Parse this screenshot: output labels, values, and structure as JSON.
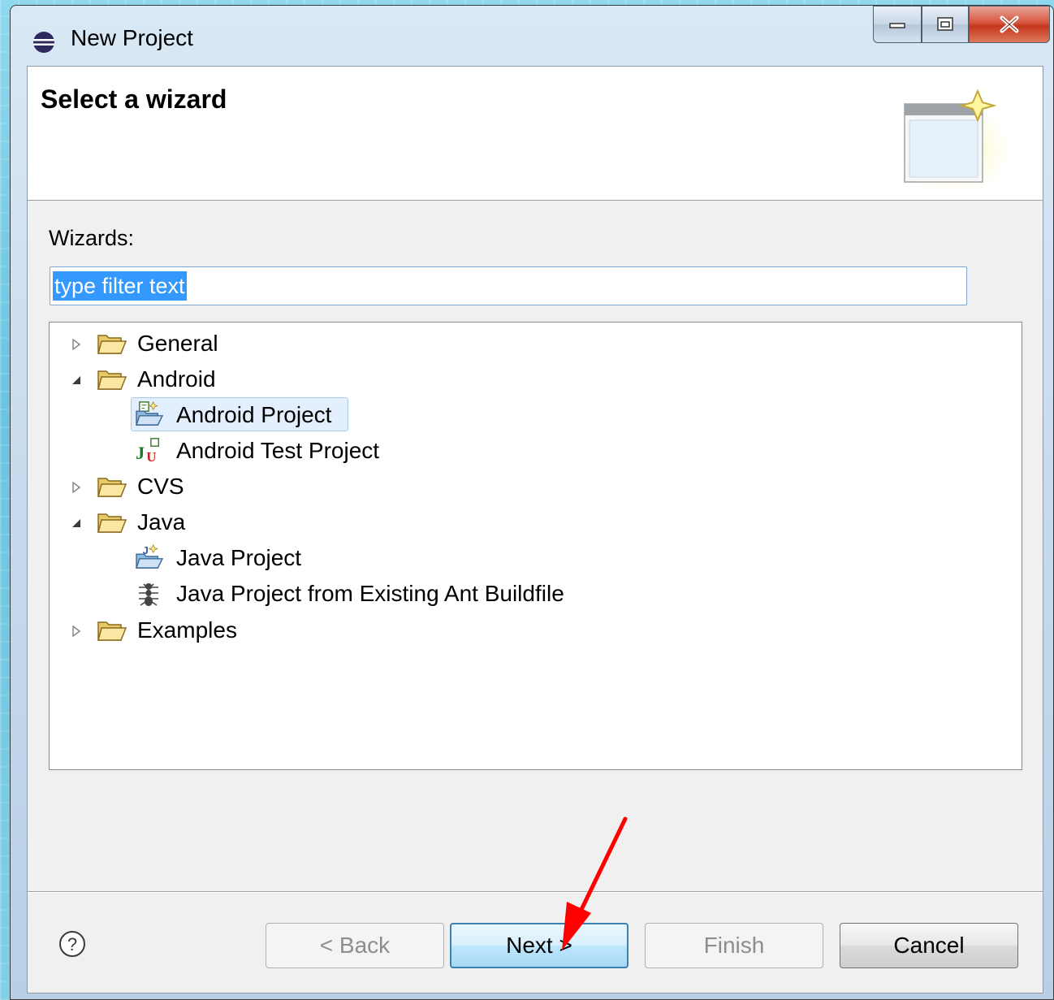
{
  "window": {
    "title": "New Project",
    "controls": [
      "minimize",
      "maximize",
      "close"
    ]
  },
  "banner": {
    "title": "Select a wizard"
  },
  "wizards": {
    "label": "Wizards:",
    "filter_value": "type filter text"
  },
  "tree": {
    "items": [
      {
        "label": "General",
        "expanded": false
      },
      {
        "label": "Android",
        "expanded": true
      },
      {
        "label": "Android Project",
        "selected": true
      },
      {
        "label": "Android Test Project"
      },
      {
        "label": "CVS",
        "expanded": false
      },
      {
        "label": "Java",
        "expanded": true
      },
      {
        "label": "Java Project"
      },
      {
        "label": "Java Project from Existing Ant Buildfile"
      },
      {
        "label": "Examples",
        "expanded": false
      }
    ]
  },
  "buttons": {
    "help": "?",
    "back": "< Back",
    "next": "Next >",
    "finish": "Finish",
    "cancel": "Cancel"
  },
  "colors": {
    "selection": "#3399ff",
    "annotation_arrow": "#ff0000",
    "background": "#8fd8ee"
  }
}
